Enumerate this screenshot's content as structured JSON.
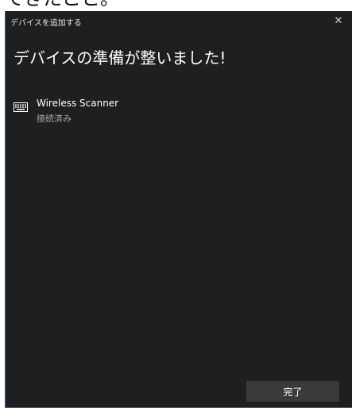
{
  "background_caption": "できたこと。",
  "window": {
    "title": "デバイスを追加する",
    "close_icon": "✕"
  },
  "main": {
    "heading": "デバイスの準備が整いました!",
    "devices": [
      {
        "icon": "keyboard-icon",
        "name": "Wireless Scanner",
        "status": "接続済み"
      }
    ]
  },
  "footer": {
    "done_label": "完了"
  },
  "colors": {
    "window_bg": "#1f1f1f",
    "button_bg": "#3a3a3a",
    "text_primary": "#ffffff",
    "text_secondary": "#a9a9a9",
    "border_accent": "#2b5fa8"
  }
}
